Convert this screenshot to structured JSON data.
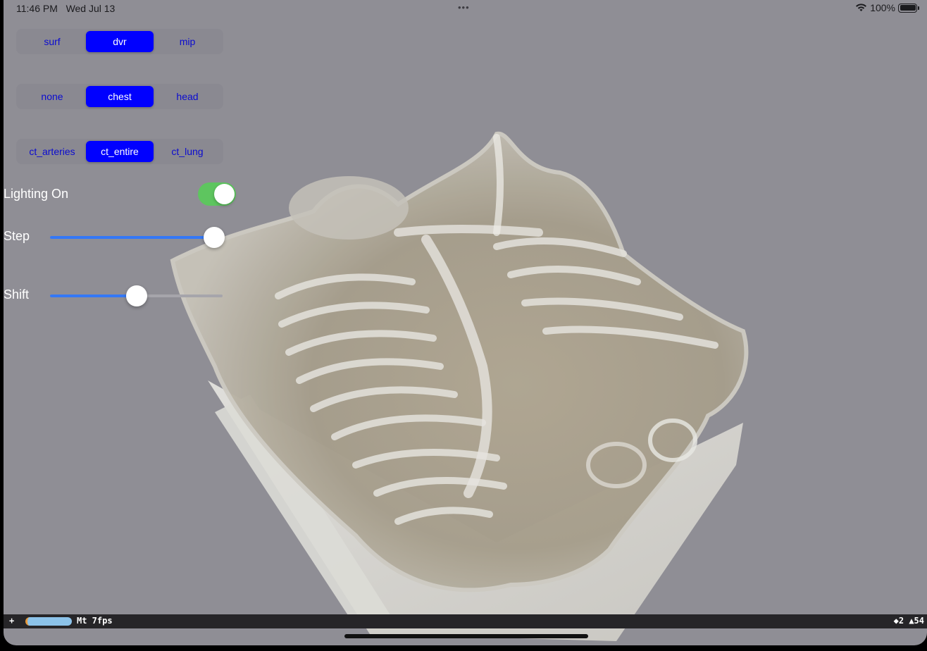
{
  "status": {
    "time": "11:46 PM",
    "date": "Wed Jul 13",
    "dots": "•••",
    "wifi_icon": "wifi-icon",
    "battery_pct": "100%",
    "battery_level": 1.0
  },
  "render_modes": {
    "items": [
      "surf",
      "dvr",
      "mip"
    ],
    "selected": "dvr"
  },
  "presets": {
    "items": [
      "none",
      "chest",
      "head"
    ],
    "selected": "chest"
  },
  "transfer": {
    "items": [
      "ct_arteries",
      "ct_entire",
      "ct_lung"
    ],
    "selected": "ct_entire"
  },
  "lighting": {
    "label": "Lighting On",
    "on": true
  },
  "step": {
    "label": "Step",
    "value": 0.95
  },
  "shift": {
    "label": "Shift",
    "value": 0.5
  },
  "debug": {
    "plus": "+",
    "fps": "Mt 7fps",
    "stats": "◆2 ▲54"
  },
  "colors": {
    "background": "#8f8e95",
    "segment_active": "#0000ff",
    "segment_text": "#0b0bd0",
    "toggle_on": "#5ec55f",
    "slider_fill": "#3478f6"
  }
}
